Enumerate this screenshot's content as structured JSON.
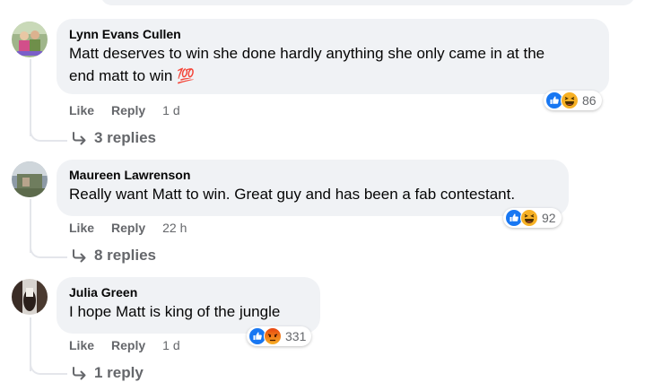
{
  "comments": [
    {
      "author": "Lynn Evans Cullen",
      "text_line1": "Matt deserves to win she done hardly anything she only came in at the",
      "text_line2": "end matt to win",
      "emoji": "💯",
      "like": "Like",
      "reply": "Reply",
      "time": "1 d",
      "reaction_count": "86",
      "reactions": [
        "like-icon",
        "haha-icon"
      ],
      "replies": "3 replies"
    },
    {
      "author": "Maureen Lawrenson",
      "text_line1": "Really want Matt to win. Great guy and has been a fab contestant.",
      "like": "Like",
      "reply": "Reply",
      "time": "22 h",
      "reaction_count": "92",
      "reactions": [
        "like-icon",
        "haha-icon"
      ],
      "replies": "8 replies"
    },
    {
      "author": "Julia Green",
      "text_line1": "I hope Matt is king of the jungle",
      "like": "Like",
      "reply": "Reply",
      "time": "1 d",
      "reaction_count": "331",
      "reactions": [
        "like-icon",
        "angry-icon"
      ],
      "replies": "1 reply"
    }
  ],
  "colors": {
    "bubble": "#f0f2f5",
    "secondary_text": "#65676b",
    "like_blue": "#1877f2",
    "haha_yellow": "#f7b125",
    "angry_red": "#e9710f"
  }
}
